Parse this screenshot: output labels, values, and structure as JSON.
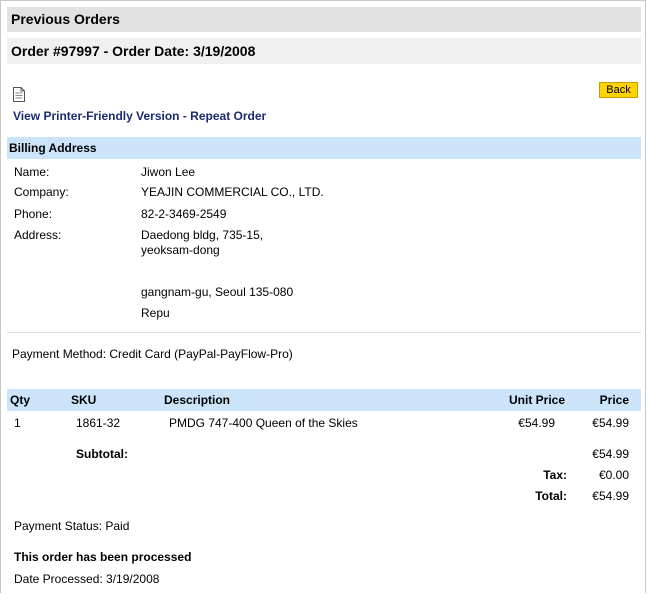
{
  "header": {
    "title": "Previous Orders"
  },
  "order": {
    "title": "Order #97997 - Order Date: 3/19/2008"
  },
  "actions": {
    "back_label": "Back",
    "printer_friendly": "View Printer-Friendly Version",
    "separator": " - ",
    "repeat_order": "Repeat Order"
  },
  "billing": {
    "heading": "Billing Address",
    "name_label": "Name:",
    "name": "Jiwon Lee",
    "company_label": "Company:",
    "company": "YEAJIN COMMERCIAL CO., LTD.",
    "phone_label": "Phone:",
    "phone": "82-2-3469-2549",
    "address_label": "Address:",
    "address_line1": "Daedong bldg, 735-15,",
    "address_line2": "yeoksam-dong",
    "address_line3": "gangnam-gu, Seoul 135-080",
    "address_line4": "Repu"
  },
  "payment_method": "Payment Method: Credit Card (PayPal-PayFlow-Pro)",
  "items": {
    "headers": {
      "qty": "Qty",
      "sku": "SKU",
      "description": "Description",
      "unit_price": "Unit Price",
      "price": "Price"
    },
    "rows": [
      {
        "qty": "1",
        "sku": "1861-32",
        "description": "PMDG 747-400 Queen of the Skies",
        "unit_price": "€54.99",
        "price": "€54.99"
      }
    ]
  },
  "totals": {
    "subtotal_label": "Subtotal:",
    "subtotal": "€54.99",
    "tax_label": "Tax:",
    "tax": "€0.00",
    "total_label": "Total:",
    "total": "€54.99"
  },
  "status": {
    "payment_status": "Payment Status: Paid",
    "processed_heading": "This order has been processed",
    "date_processed": "Date Processed: 3/19/2008"
  },
  "colors": {
    "section_header_bg": "#cbe4fa",
    "title_bar_bg": "#e2e2e2",
    "back_button_bg": "#ffd200",
    "link_color": "#1c2b6e"
  }
}
